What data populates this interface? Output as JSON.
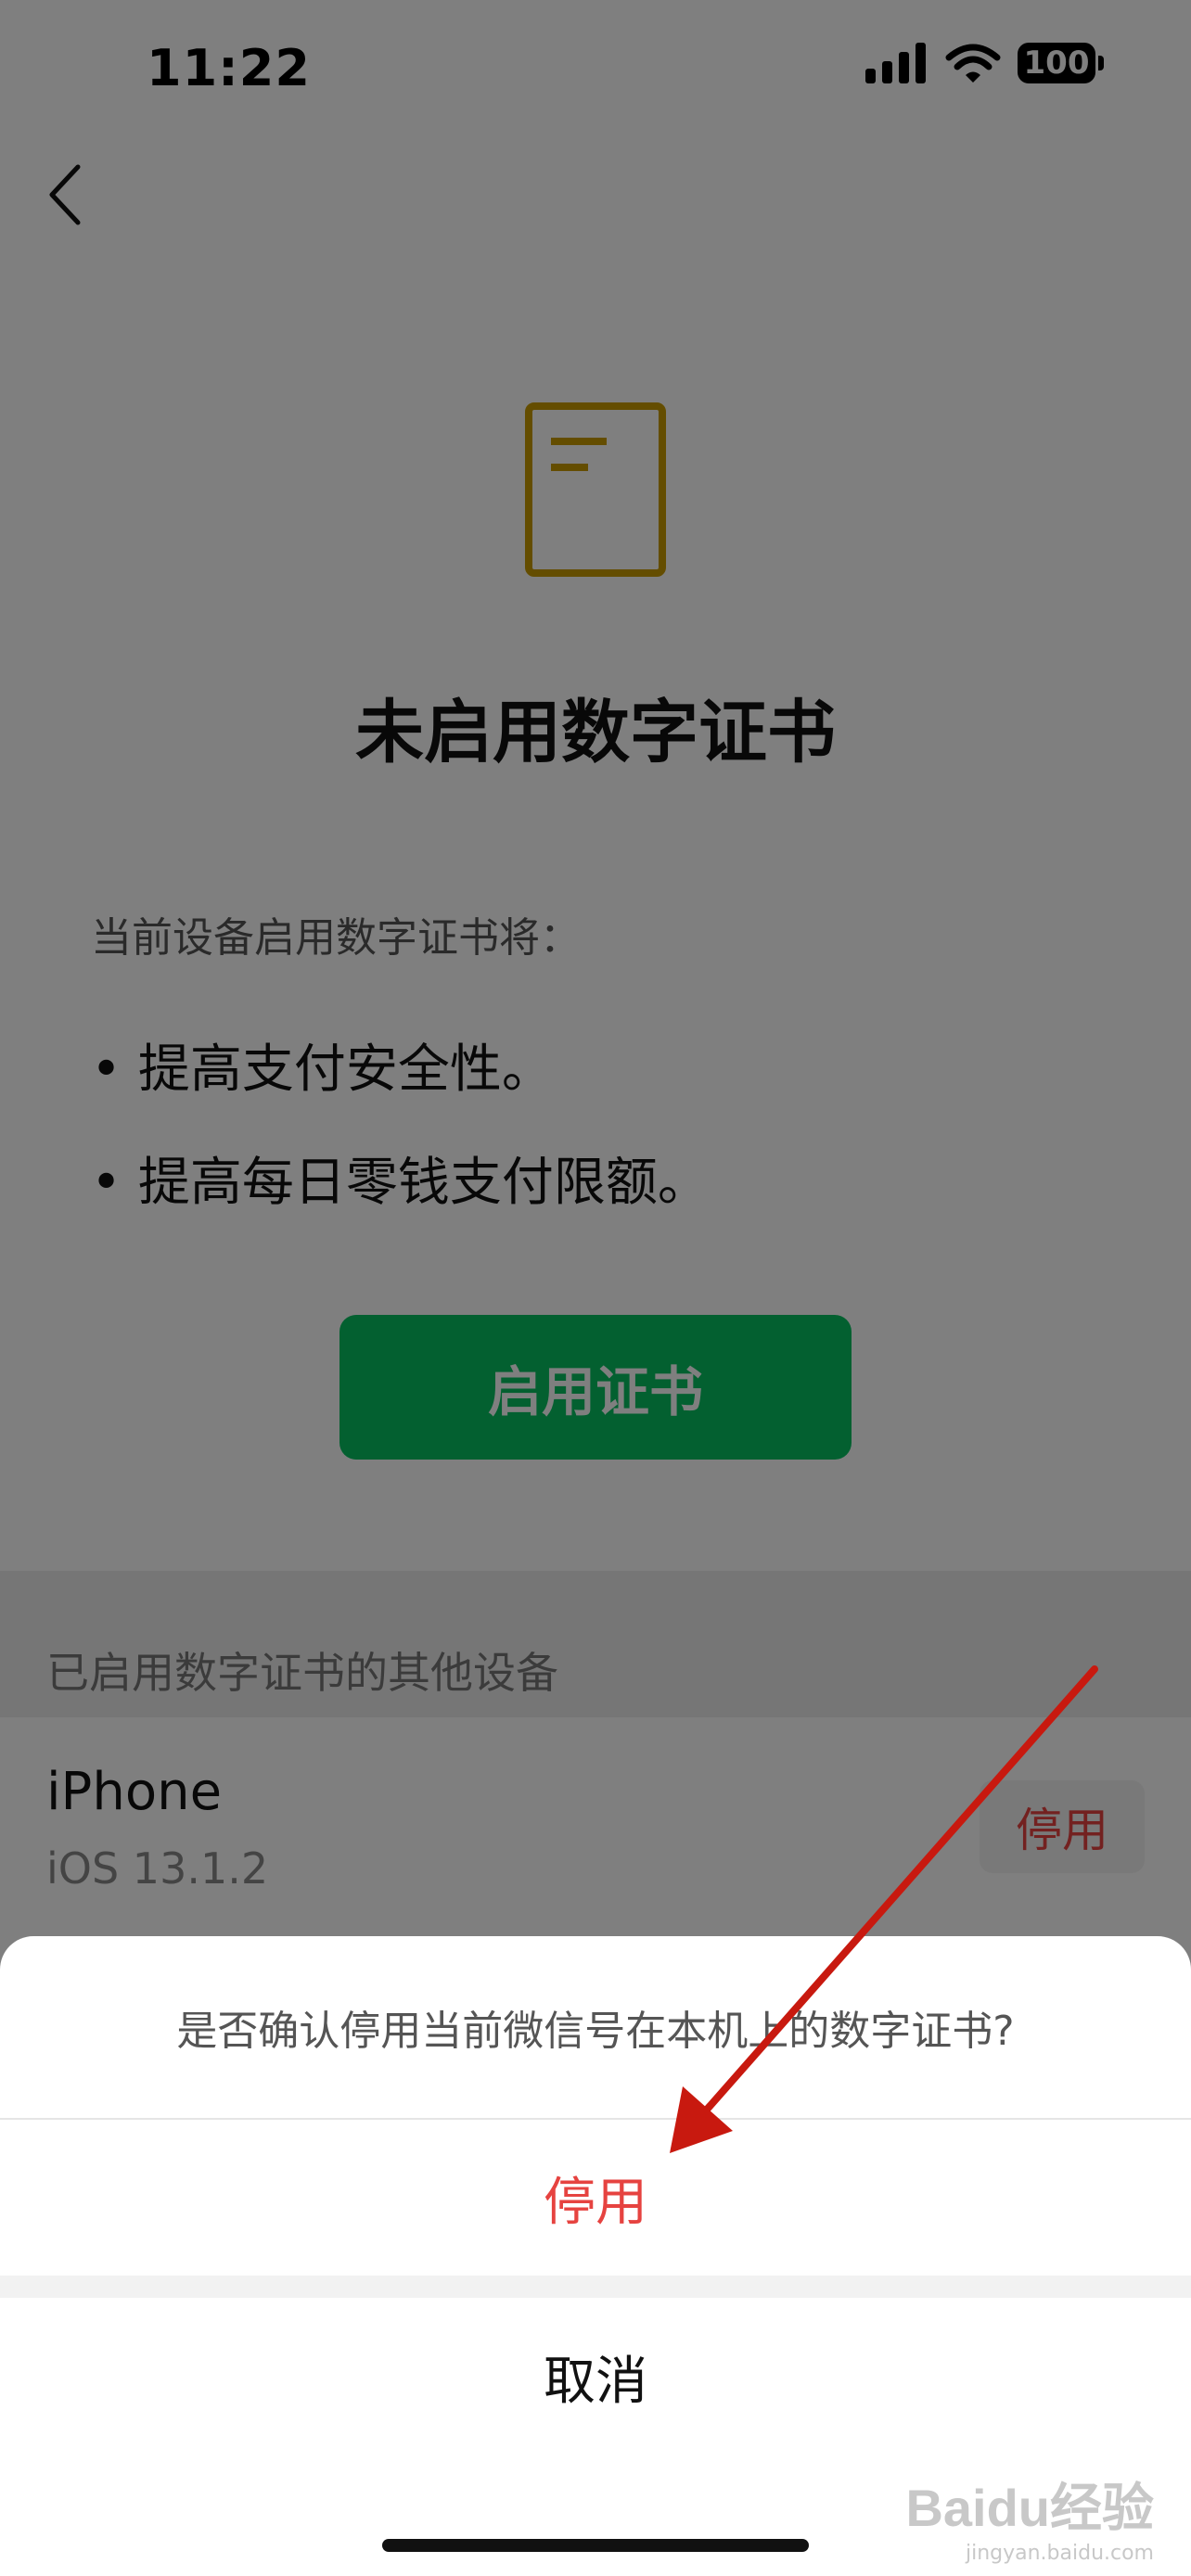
{
  "status_bar": {
    "time": "11:22",
    "battery": "100"
  },
  "page": {
    "title": "未启用数字证书",
    "description": "当前设备启用数字证书将：",
    "bullets": [
      "• 提高支付安全性。",
      "• 提高每日零钱支付限额。"
    ],
    "enable_button": "启用证书",
    "icon_color": "#c89b00"
  },
  "other_devices": {
    "section_label": "已启用数字证书的其他设备",
    "devices": [
      {
        "name": "iPhone",
        "version": "iOS 13.1.2",
        "action": "停用"
      }
    ]
  },
  "action_sheet": {
    "message": "是否确认停用当前微信号在本机上的数字证书?",
    "confirm": "停用",
    "cancel": "取消"
  },
  "colors": {
    "accent_green": "#07c160",
    "danger_red": "#e64340",
    "arrow_red": "#c8190f"
  },
  "watermark": {
    "logo": "Baidu经验",
    "url": "jingyan.baidu.com"
  }
}
